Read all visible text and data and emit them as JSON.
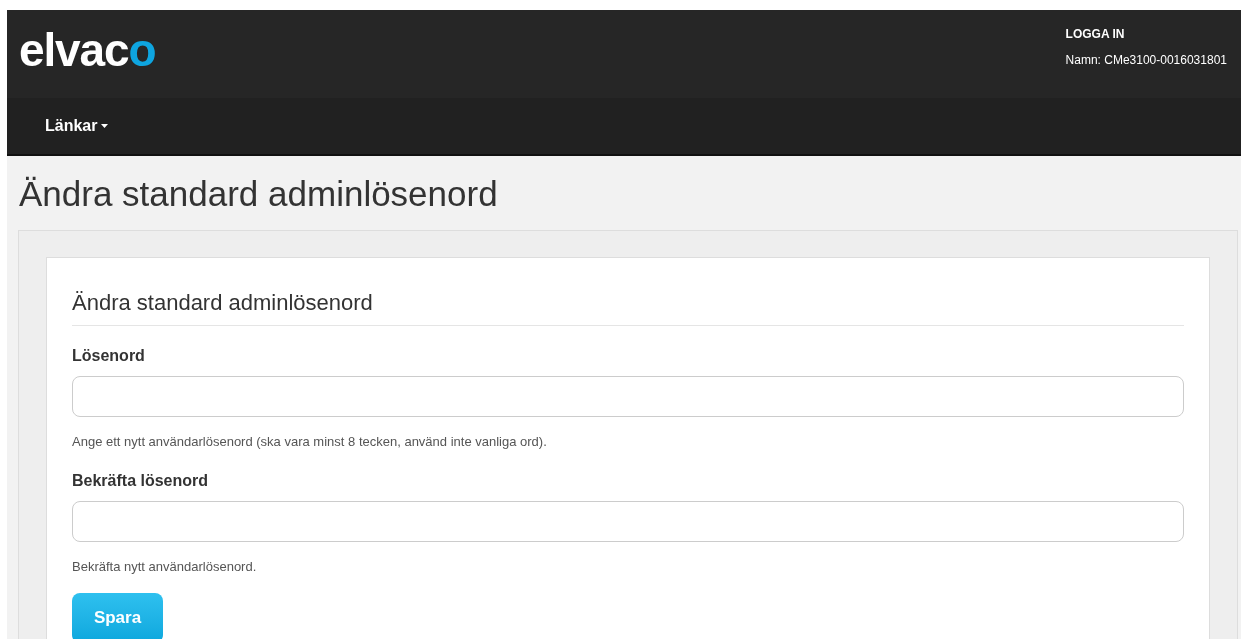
{
  "header": {
    "logo": "elvaco",
    "login": "LOGGA IN",
    "name": "Namn: CMe3100-0016031801"
  },
  "nav": {
    "items": [
      {
        "label": "Länkar",
        "dropdown": true
      }
    ]
  },
  "page_title": "Ändra standard adminlösenord",
  "form": {
    "title": "Ändra standard adminlösenord",
    "fields": [
      {
        "label": "Lösenord",
        "help": "Ange ett nytt användarlösenord (ska vara minst 8 tecken, använd inte vanliga ord)."
      },
      {
        "label": "Bekräfta lösenord",
        "help": "Bekräfta nytt användarlösenord."
      }
    ],
    "button": "Spara"
  }
}
